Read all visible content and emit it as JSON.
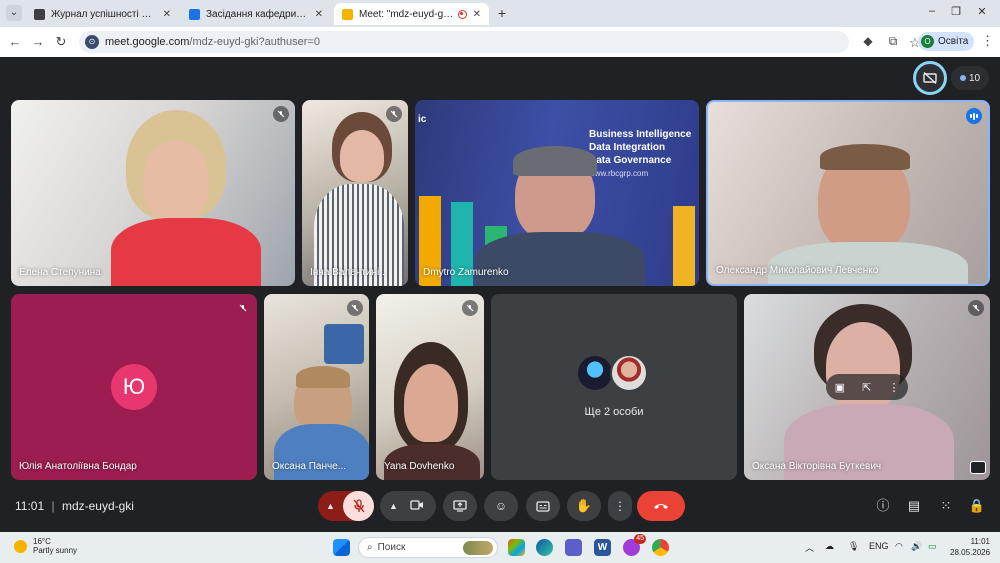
{
  "browser": {
    "tabs": [
      {
        "title": "Журнал успішності для курсу \"",
        "favicon_color": "#3c4043"
      },
      {
        "title": "Засідання кафедри – Клас",
        "favicon_color": "#1a73e8"
      },
      {
        "title": "Meet: \"mdz-euyd-gki\"",
        "favicon_color": "#f4b400"
      }
    ],
    "new_tab": "+",
    "url_host": "meet.google.com",
    "url_path": "/mdz-euyd-gki?authuser=0",
    "profile_initial": "О",
    "profile_name": "Освіта"
  },
  "meet": {
    "participants_count": "10",
    "tiles": [
      {
        "name": "Елена Степунина"
      },
      {
        "name": "Інна Валентині..."
      },
      {
        "name": "Dmytro Zamurenko"
      },
      {
        "name": "Олександр Миколайович Левченко"
      },
      {
        "name": "Юлія Анатоліївна Бондар",
        "avatar_letter": "Ю"
      },
      {
        "name": "Оксана Панче..."
      },
      {
        "name": "Yana Dovhenko"
      },
      {
        "name": "Ще 2 особи"
      },
      {
        "name": "Оксана Вікторівна Буткевич"
      }
    ],
    "background_banner": {
      "logo_fragment": "ic",
      "lines": [
        "Business Intelligence",
        "Data Integration",
        "Data Governance"
      ],
      "site": "www.rbcgrp.com"
    },
    "time": "11:01",
    "meeting_code": "mdz-euyd-gki"
  },
  "taskbar": {
    "temperature": "16°C",
    "weather": "Partly sunny",
    "search_placeholder": "Поиск",
    "notification_badge": "45",
    "language": "ENG",
    "time": "11:01",
    "date": "28.05.2026"
  }
}
